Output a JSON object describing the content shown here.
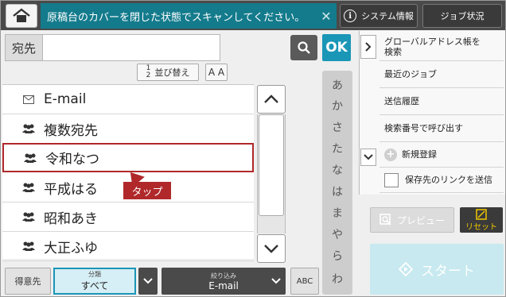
{
  "header": {
    "message": "原稿台のカバーを閉じた状態でスキャンしてください。",
    "system_info_label": "システム情報",
    "job_status_label": "ジョブ状況"
  },
  "search": {
    "label": "宛先",
    "value": "",
    "ok_label": "OK"
  },
  "sort": {
    "label": "並び替え",
    "font_size_glyph": "A A"
  },
  "list": {
    "items": [
      {
        "label": "E-mail",
        "icon": "envelope-icon"
      },
      {
        "label": "複数宛先",
        "icon": "group-icon"
      },
      {
        "label": "令和なつ",
        "icon": "group-icon",
        "selected": true
      },
      {
        "label": "平成はる",
        "icon": "group-icon"
      },
      {
        "label": "昭和あき",
        "icon": "group-icon"
      },
      {
        "label": "大正ふゆ",
        "icon": "group-icon"
      }
    ]
  },
  "callout": {
    "label": "タップ"
  },
  "kana_index": [
    "あ",
    "か",
    "さ",
    "た",
    "な",
    "は",
    "ま",
    "や",
    "ら",
    "わ"
  ],
  "bottom": {
    "favorites_label": "得意先",
    "classification_caption": "分類",
    "classification_value": "すべて",
    "filter_caption": "絞り込み",
    "filter_value": "E-mail",
    "abc_label": "ABC"
  },
  "right_menu": {
    "items": [
      "グローバルアドレス帳を\n検索",
      "最近のジョブ",
      "送信履歴",
      "検索番号で呼び出す",
      "新規登録",
      "保存先のリンクを送信"
    ]
  },
  "actions": {
    "preview_label": "プレビュー",
    "reset_label": "リセット",
    "start_label": "スタート"
  },
  "colors": {
    "accent": "#1a96b7",
    "message_bar": "#137b8c",
    "callout": "#b0282a",
    "start": "#c7e9ef",
    "reset_text": "#f0c800"
  }
}
